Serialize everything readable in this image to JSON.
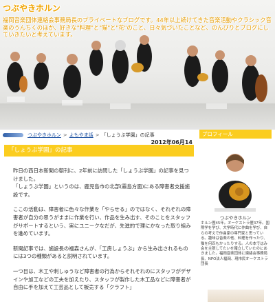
{
  "header": {
    "site_title": "つぶやきホルン",
    "description": "福岡音楽団体連絡会事務局長のプライベートなブログです。44年以上続けてきた音楽活動やクラシック音楽のうんちくのほか、好きな\"料理\"と\"猫\"と\"花\"のこと、日々気づいたことなど、のんびりとブログにしていきたいと考えています。"
  },
  "breadcrumb": {
    "home": "つぶやきホルン",
    "category": "よもやま話",
    "current": "「しょうぶ学園」の記事"
  },
  "post": {
    "date": "2012年06月14日",
    "title": "「しょうぶ学園」の記事",
    "paragraphs": [
      "昨日の西日本新聞の朝刊に、2年前に訪問した「しょうぶ学園」の記事を見つけました。",
      "「しょうぶ学園」というのは、鹿児島市の北部(霧島方面)にある障害者支援施設です。",
      "ここの活動は、障害者に色々な作業を「やらせる」のではなく、それぞれの障害者が自分の思うがままに作業を行い、作品を生み出す、そのことをスタッフがサポートするという、実にユニークなだが、先進的で理にかなった取り組みを進めています。",
      "新聞記事では、施設長の福森さんが、「工房しょうぶ」から生み出されるものには3つの種類があると説明されています。",
      "一つ目は、木工や刺しゅうなど障害者の行為からそれそれのにスタッフがデザインや加工などの工夫を加えたり、スタッフが製作した木工品などに障害者が自由に手を加えて工芸品として販売する「クラフト」"
    ]
  },
  "sidebar": {
    "profile_heading": "プロフィール",
    "profile_name": "つぶやきホルン",
    "profile_text": "ホルン歴45年。オーケストラ歴37年。国際学を学び、大学時代に作曲を学び、自らの考えで作曲家の専門家と思っている。趣味は音楽の他、料理を作ったり、猫を何匹もかったりする。人の本ではみ会を主張してたいを確立していたのにあきました。福岡音楽団体に連絡会事務局長、NPO法人福岡、現市民オーケストラ団長"
  },
  "colors": {
    "accent": "#fbcd1f",
    "title_text": "#f0a400",
    "link": "#1a4fa0"
  }
}
